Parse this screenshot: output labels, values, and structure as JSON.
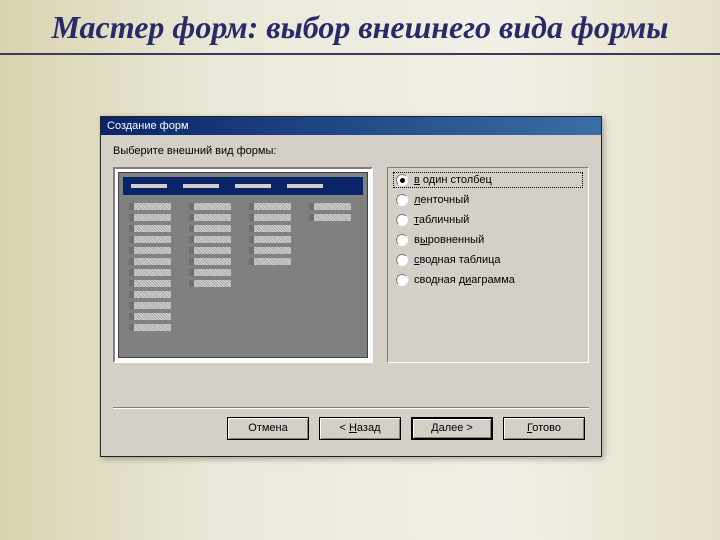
{
  "slide": {
    "title": "Мастер форм: выбор внешнего вида формы"
  },
  "dialog": {
    "title": "Создание форм",
    "instruction": "Выберите внешний вид формы:",
    "options": [
      {
        "label_pre": "",
        "u": "в",
        "label_post": " один столбец",
        "selected": true
      },
      {
        "label_pre": "",
        "u": "л",
        "label_post": "енточный",
        "selected": false
      },
      {
        "label_pre": "",
        "u": "т",
        "label_post": "абличный",
        "selected": false
      },
      {
        "label_pre": "в",
        "u": "ы",
        "label_post": "ровненный",
        "selected": false
      },
      {
        "label_pre": "",
        "u": "с",
        "label_post": "водная таблица",
        "selected": false
      },
      {
        "label_pre": "сводная д",
        "u": "и",
        "label_post": "аграмма",
        "selected": false
      }
    ],
    "buttons": {
      "cancel": "Отмена",
      "back_pre": "< ",
      "back_u": "Н",
      "back_post": "азад",
      "next_u": "Д",
      "next_post": "алее >",
      "finish_u": "Г",
      "finish_post": "отово"
    }
  }
}
